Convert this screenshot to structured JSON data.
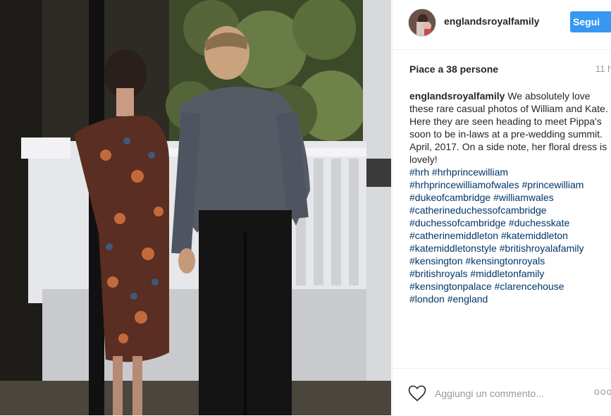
{
  "post": {
    "username": "englandsroyalfamily",
    "follow_label": "Segui",
    "likes_text": "Piace a 38 persone",
    "time_text": "11 h",
    "caption_user": "englandsroyalfamily",
    "caption_body": "We absolutely love these rare casual photos of William and Kate. Here they are seen heading to meet Pippa's soon to be in-laws at a pre-wedding summit. April, 2017. On a side note, her floral dress is lovely!",
    "hashtag_lines": [
      "#hrh #hrhprincewilliam",
      "#hrhprincewilliamofwales #princewilliam",
      "#dukeofcambridge #williamwales",
      "#catherineduchessofcambridge",
      "#duchessofcambridge #duchesskate",
      "#catherinemiddleton #katemiddleton",
      "#katemiddletonstyle #britishroyalafamily",
      "#kensington #kensingtonroyals",
      "#britishroyals #middletonfamily",
      "#kensingtonpalace #clarencehouse",
      "#london #england"
    ],
    "comment_placeholder": "Aggiungi un commento...",
    "more_label": "ooo"
  },
  "colors": {
    "accent": "#3897f0",
    "hashtag": "#003569",
    "muted": "#999999"
  },
  "icons": {
    "like": "heart-icon",
    "more": "more-options-icon"
  }
}
